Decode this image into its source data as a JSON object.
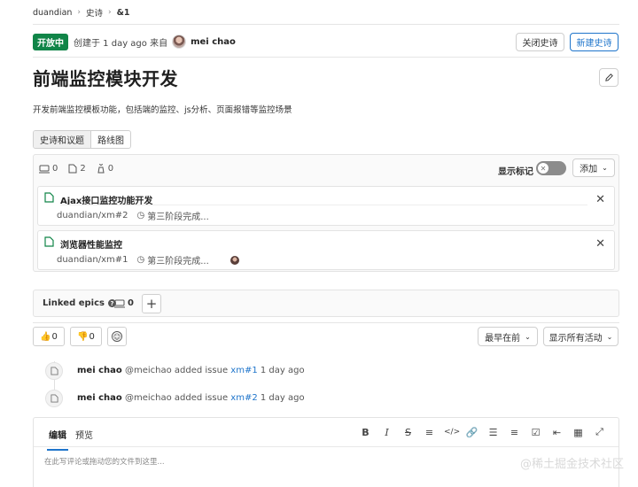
{
  "breadcrumb": {
    "items": [
      "duandian",
      "史诗",
      "&1"
    ]
  },
  "status": {
    "badge": "开放中",
    "created_prefix": "创建于 1 day ago 来自",
    "author": "mei chao"
  },
  "header_actions": {
    "close": "关闭史诗",
    "new": "新建史诗"
  },
  "epic": {
    "title": "前端监控模块开发",
    "description": "开发前端监控模板功能，包括端的监控、js分析、页面报错等监控场景"
  },
  "tabs": [
    {
      "label": "史诗和议题"
    },
    {
      "label": "路线图"
    }
  ],
  "panel": {
    "counts": {
      "epics": "0",
      "issues": "2",
      "weight": "0"
    },
    "toggle_label": "显示标记",
    "add_label": "添加",
    "items": [
      {
        "title": "Ajax接口监控功能开发",
        "ref": "duandian/xm#2",
        "milestone": "第三阶段完成..."
      },
      {
        "title": "浏览器性能监控",
        "ref": "duandian/xm#1",
        "milestone": "第三阶段完成..."
      }
    ]
  },
  "linked": {
    "label": "Linked epics",
    "count": "0",
    "plus": "+"
  },
  "reactions": {
    "thumbs_up": "0",
    "thumbs_down": "0"
  },
  "sort": {
    "order": "最早在前",
    "filter": "显示所有活动"
  },
  "timeline": [
    {
      "author": "mei chao",
      "text": "@meichao added issue",
      "link": "xm#1",
      "time": "1 day ago"
    },
    {
      "author": "mei chao",
      "text": "@meichao added issue",
      "link": "xm#2",
      "time": "1 day ago"
    }
  ],
  "editor": {
    "tab_edit": "编辑",
    "tab_preview": "预览",
    "placeholder": "在此写评论或拖动您的文件到这里..."
  },
  "watermark": "@稀土掘金技术社区"
}
